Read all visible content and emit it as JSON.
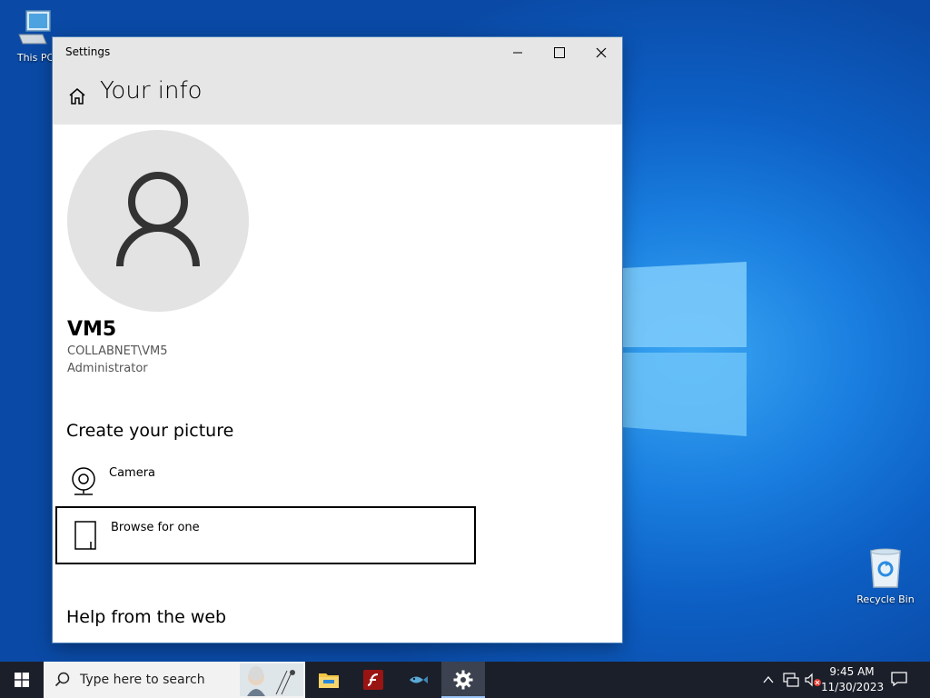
{
  "desktop": {
    "icons": [
      {
        "label": "This PC",
        "icon": "computer-icon"
      },
      {
        "label": "Recycle Bin",
        "icon": "recycle-bin-icon"
      }
    ],
    "accent": "#0a5fc2"
  },
  "window": {
    "title": "Settings",
    "page_title": "Your info",
    "user": {
      "name": "VM5",
      "domain": "COLLABNET\\VM5",
      "role": "Administrator"
    },
    "create_picture": {
      "heading": "Create your picture",
      "options": [
        {
          "label": "Camera",
          "icon": "camera-icon"
        },
        {
          "label": "Browse for one",
          "icon": "browse-file-icon",
          "focused": true
        }
      ]
    },
    "help_heading": "Help from the web"
  },
  "taskbar": {
    "search_placeholder": "Type here to search",
    "apps": [
      {
        "name": "file-explorer",
        "icon": "folder-icon"
      },
      {
        "name": "flash",
        "icon": "flash-icon"
      },
      {
        "name": "network-app",
        "icon": "fish-icon"
      },
      {
        "name": "settings",
        "icon": "gear-icon",
        "active": true
      }
    ],
    "clock": {
      "time": "9:45 AM",
      "date": "11/30/2023"
    }
  }
}
